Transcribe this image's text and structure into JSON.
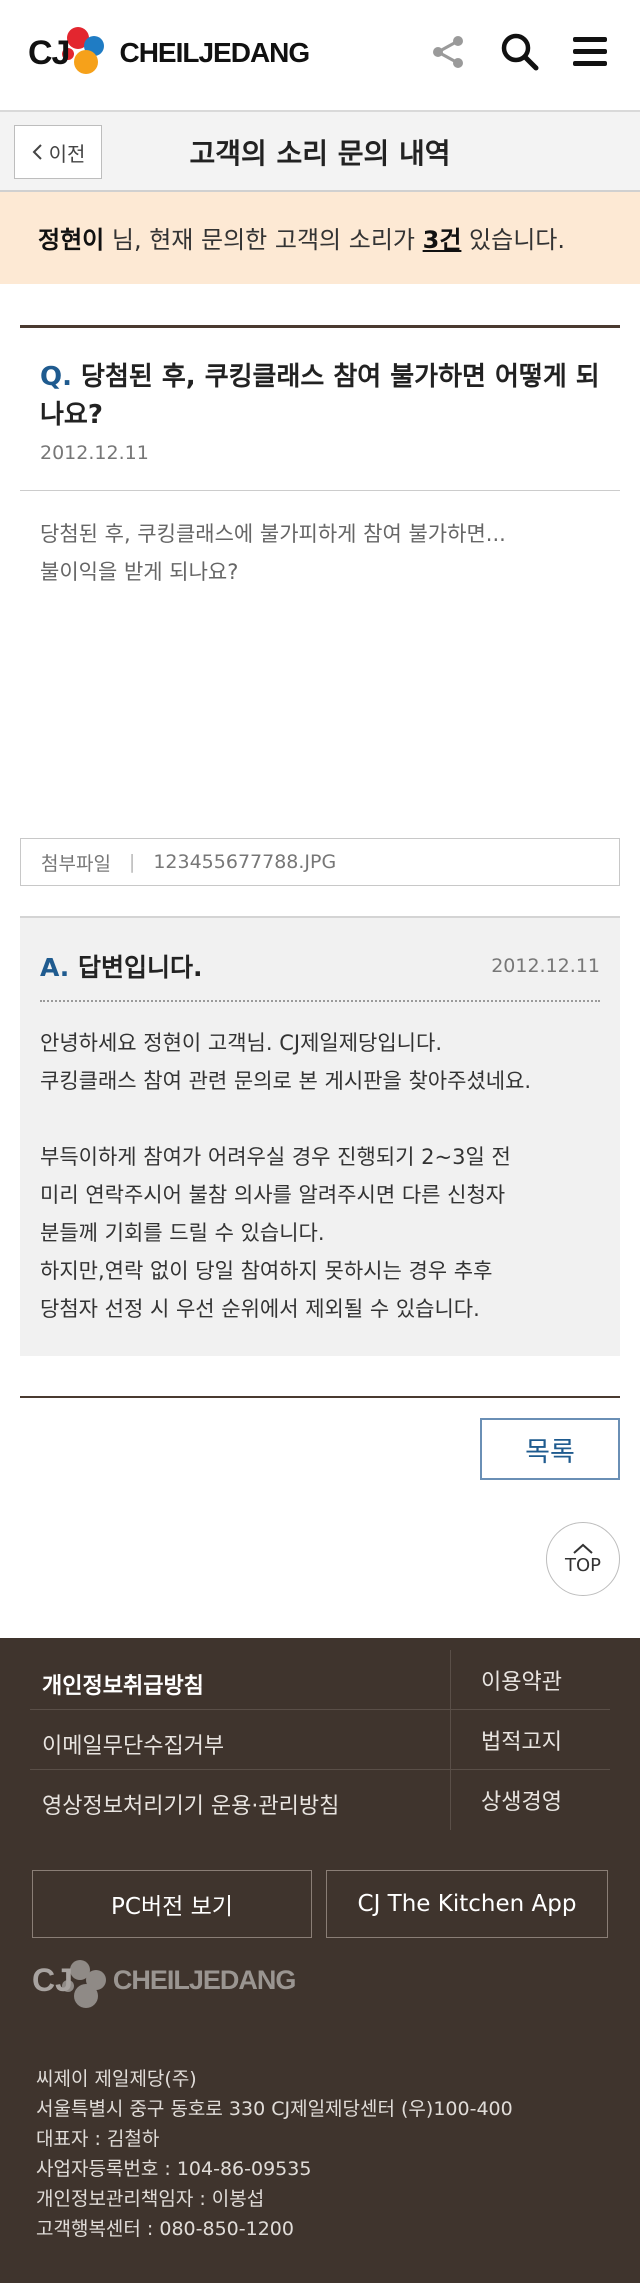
{
  "header": {
    "logo_cj": "CJ",
    "logo_word": "CHEILJEDANG",
    "icons": [
      "share-icon",
      "search-icon",
      "menu-icon"
    ]
  },
  "subheader": {
    "back_label": "이전",
    "title": "고객의 소리 문의 내역"
  },
  "notice": {
    "user_name": "정현이",
    "text_mid": " 님, 현재 문의한 고객의 소리가 ",
    "count": "3건",
    "text_end": " 있습니다."
  },
  "question": {
    "mark": "Q.",
    "title": "당첨된 후, 쿠킹클래스 참여 불가하면 어떻게 되나요?",
    "date": "2012.12.11",
    "body_line1": "당첨된 후, 쿠킹클래스에 불가피하게 참여 불가하면...",
    "body_line2": "불이익을 받게 되나요?"
  },
  "attachment": {
    "label": "첨부파일",
    "separator": "|",
    "filename": "123455677788.JPG"
  },
  "answer": {
    "mark": "A.",
    "title": "답변입니다.",
    "date": "2012.12.11",
    "body": "안녕하세요 정현이 고객님. CJ제일제당입니다.\n쿠킹클래스 참여 관련 문의로 본 게시판을 찾아주셨네요.\n\n부득이하게 참여가 어려우실 경우 진행되기 2~3일 전\n미리 연락주시어 불참 의사를 알려주시면 다른 신청자\n분들께 기회를 드릴 수 있습니다.\n하지만,연락 없이 당일 참여하지 못하시는 경우 추후\n당첨자 선정 시 우선 순위에서 제외될 수 있습니다."
  },
  "buttons": {
    "list_label": "목록",
    "top_label": "TOP"
  },
  "footer": {
    "links": [
      {
        "left": "개인정보취급방침",
        "right": "이용약관"
      },
      {
        "left": "이메일무단수집거부",
        "right": "법적고지"
      },
      {
        "left": "영상정보처리기기 운용·관리방침",
        "right": "상생경영"
      }
    ],
    "pc_version": "PC버전 보기",
    "app_button": "CJ The Kitchen App",
    "logo_cj": "CJ",
    "logo_word": "CHEILJEDANG",
    "company": "씨제이 제일제당(주)",
    "address": "서울특별시 중구 동호로 330 CJ제일제당센터 (우)100-400",
    "ceo": "대표자 : 김철하",
    "biz_no": "사업자등록번호 : 104-86-09535",
    "privacy_officer": "개인정보관리책임자 : 이봉섭",
    "call_center": "고객행복센터 : 080-850-1200"
  },
  "colors": {
    "accent_blue": "#1f5b8f",
    "notice_bg": "#fde9d4",
    "footer_bg": "#3f342d",
    "divider_brown": "#4a3a30"
  }
}
